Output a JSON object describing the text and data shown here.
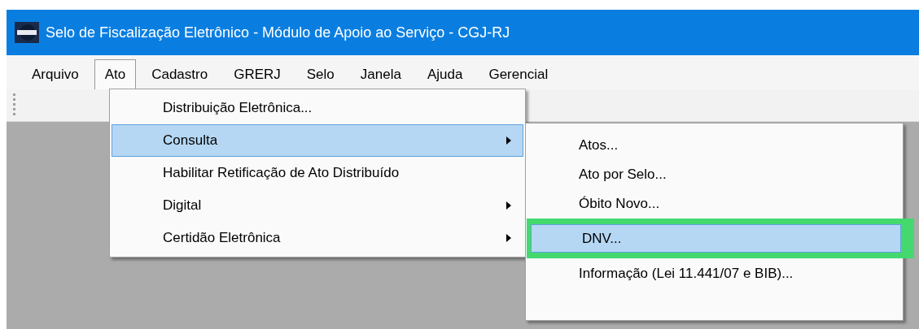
{
  "window": {
    "title": "Selo de Fiscalização Eletrônico - Módulo de Apoio ao Serviço - CGJ-RJ"
  },
  "menu_bar": [
    {
      "label": "Arquivo",
      "selected": false
    },
    {
      "label": "Ato",
      "selected": true
    },
    {
      "label": "Cadastro",
      "selected": false
    },
    {
      "label": "GRERJ",
      "selected": false
    },
    {
      "label": "Selo",
      "selected": false
    },
    {
      "label": "Janela",
      "selected": false
    },
    {
      "label": "Ajuda",
      "selected": false
    },
    {
      "label": "Gerencial",
      "selected": false
    }
  ],
  "ato_menu": [
    {
      "label": "Distribuição Eletrônica...",
      "selected": false,
      "has_submenu": false
    },
    {
      "label": "Consulta",
      "selected": true,
      "has_submenu": true
    },
    {
      "label": "Habilitar Retificação de Ato Distribuído",
      "selected": false,
      "has_submenu": false
    },
    {
      "label": "Digital",
      "selected": false,
      "has_submenu": true
    },
    {
      "label": "Certidão Eletrônica",
      "selected": false,
      "has_submenu": true
    }
  ],
  "consulta_submenu": [
    {
      "label": "Atos...",
      "selected": false,
      "highlighted": false
    },
    {
      "label": "Ato por Selo...",
      "selected": false,
      "highlighted": false
    },
    {
      "label": "Óbito Novo...",
      "selected": false,
      "highlighted": false
    },
    {
      "label": "DNV...",
      "selected": true,
      "highlighted": true
    },
    {
      "label": "Informação (Lei 11.441/07 e BIB)...",
      "selected": false,
      "highlighted": false
    }
  ]
}
